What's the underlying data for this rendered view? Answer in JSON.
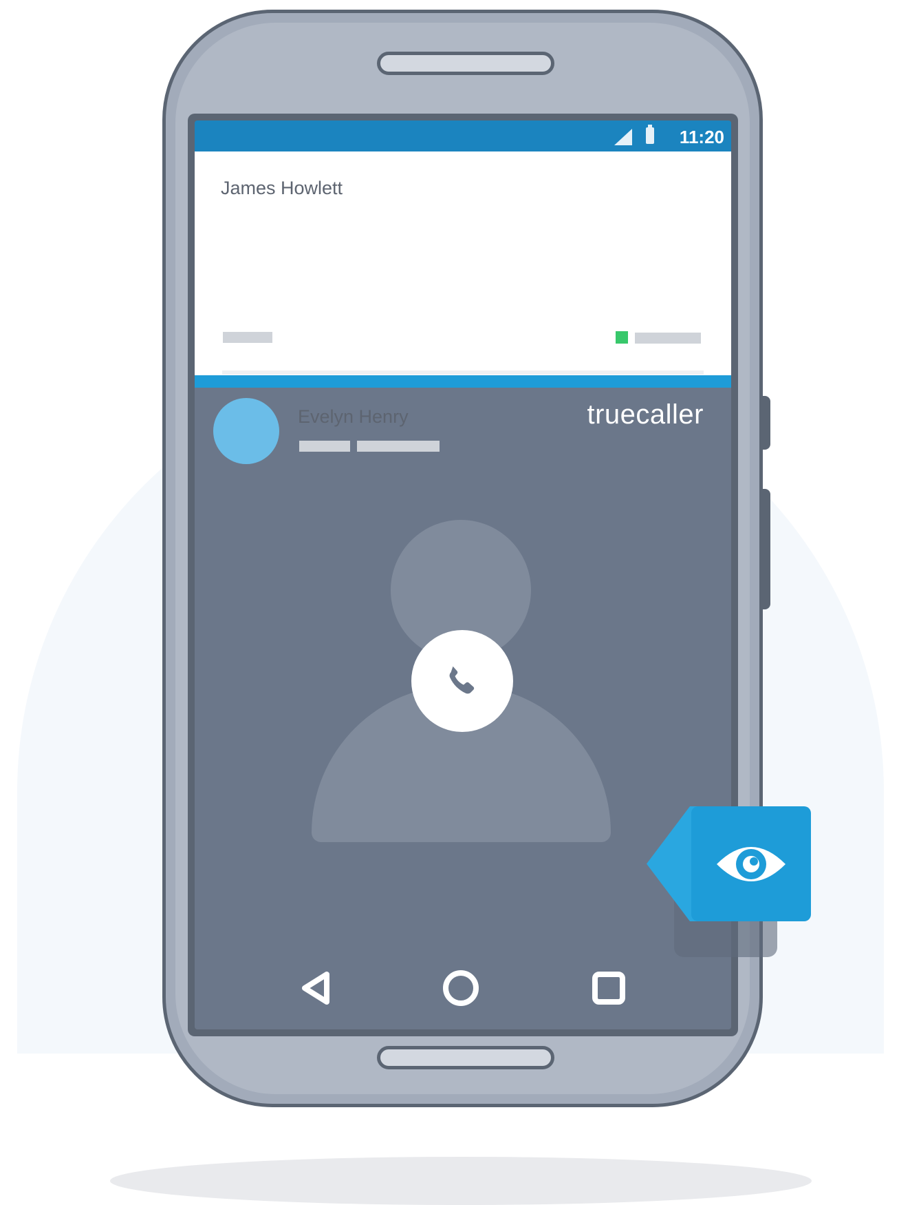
{
  "status_bar": {
    "time": "11:20"
  },
  "card": {
    "contact_1": {
      "name": "James Howlett"
    },
    "contact_2": {
      "name": "Evelyn Henry"
    }
  },
  "brand": {
    "logo_text": "truecaller"
  },
  "colors": {
    "accent": "#1e9cd8",
    "status_bar": "#1b84bf",
    "screen_bg": "#6b778a",
    "online_indicator": "#38c86b",
    "avatar": "#6bbde8"
  },
  "icons": {
    "signal": "signal-icon",
    "battery": "battery-icon",
    "call": "phone-icon",
    "back": "back-triangle-icon",
    "home": "home-circle-icon",
    "recents": "recents-square-icon",
    "eye": "eye-icon"
  }
}
